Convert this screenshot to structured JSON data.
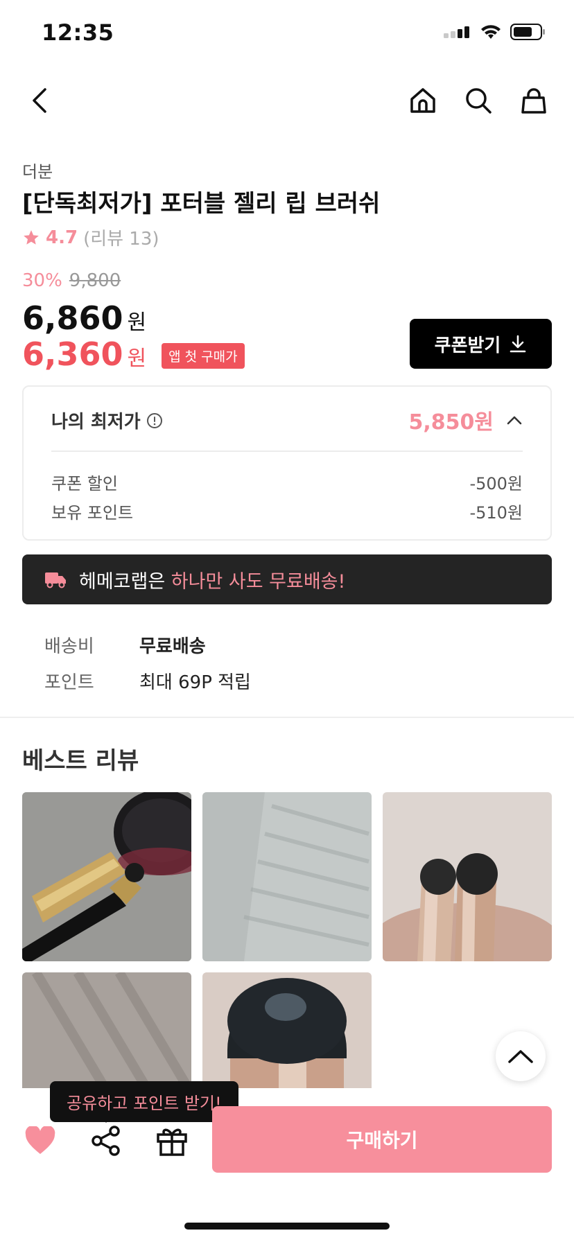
{
  "status_bar": {
    "time": "12:35"
  },
  "product": {
    "brand": "더분",
    "title": "[단독최저가] 포터블 젤리 립 브러쉬",
    "rating": "4.7",
    "review_count": "(리뷰 13)",
    "discount_percent": "30%",
    "original_price": "9,800",
    "price": "6,860",
    "price_unit": "원",
    "app_price": "6,360",
    "app_badge": "앱 첫 구매가"
  },
  "coupon_button": {
    "label": "쿠폰받기"
  },
  "lowest_price": {
    "label": "나의 최저가",
    "value": "5,850원",
    "lines": [
      {
        "label": "쿠폰 할인",
        "value": "-500원"
      },
      {
        "label": "보유 포인트",
        "value": "-510원"
      }
    ]
  },
  "free_shipping_banner": {
    "prefix": "헤메코랩은",
    "highlight": "하나만 사도 무료배송!"
  },
  "shipping_info": [
    {
      "label": "배송비",
      "value": "무료배송"
    },
    {
      "label": "포인트",
      "value": "최대 69P 적립"
    }
  ],
  "best_reviews": {
    "title": "베스트 리뷰"
  },
  "bottom_bar": {
    "tooltip": "공유하고 포인트 받기!",
    "buy_label": "구매하기"
  },
  "colors": {
    "accent_pink": "#f58d9a",
    "sale_red": "#f0535c",
    "buy_button": "#f78f9c",
    "dark_banner": "#242424"
  }
}
